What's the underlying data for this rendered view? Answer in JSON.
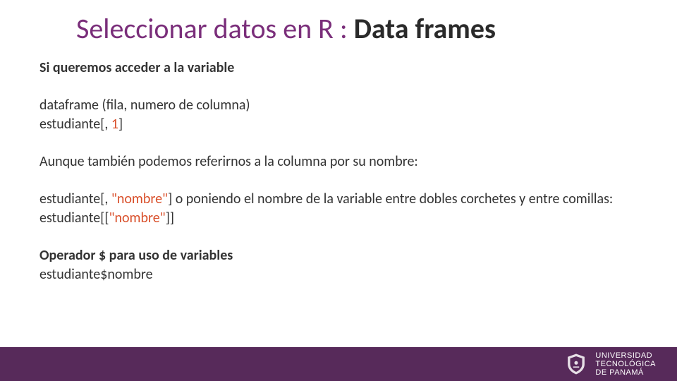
{
  "title": {
    "part1": "Seleccionar datos en R : ",
    "part2": "Data frames"
  },
  "content": {
    "heading1": "Si queremos acceder a la variable",
    "line1": "dataframe (fila, numero de columna)",
    "line2a": "estudiante[, ",
    "line2b": "1",
    "line2c": "]",
    "line3": "Aunque también podemos referirnos a la columna por su nombre:",
    "line4a": "estudiante[, ",
    "line4b": "\"nombre\"",
    "line4c": "] o poniendo el nombre de la variable entre dobles corchetes y entre comillas:",
    "line5a": "estudiante[[",
    "line5b": "\"nombre\"",
    "line5c": "]]",
    "heading2": "Operador $ para uso de variables",
    "line6": "estudiante$nombre"
  },
  "footer": {
    "org_line1": "UNIVERSIDAD",
    "org_line2": "TECNOLÓGICA",
    "org_line3": "DE PANAMÁ"
  }
}
